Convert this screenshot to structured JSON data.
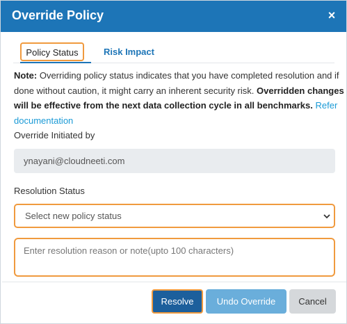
{
  "dialog": {
    "title": "Override Policy",
    "close_glyph": "×"
  },
  "tabs": [
    {
      "label": "Policy Status",
      "active": true
    },
    {
      "label": "Risk Impact",
      "active": false
    }
  ],
  "note": {
    "prefix": "Note:",
    "text": " Overriding policy status indicates that you have completed resolution and if done without caution, it might carry an inherent security risk. ",
    "bold": "Overridden changes will be effective from the next data collection cycle in all benchmarks.",
    "link": "Refer documentation"
  },
  "override_initiated": {
    "label": "Override Initiated by",
    "value": "ynayani@cloudneeti.com"
  },
  "resolution": {
    "label": "Resolution Status",
    "select_value": "Select new policy status",
    "note_placeholder": "Enter resolution reason or note(upto 100 characters)"
  },
  "buttons": {
    "resolve": "Resolve",
    "undo": "Undo Override",
    "cancel": "Cancel"
  },
  "colors": {
    "header": "#1d75b7",
    "focus_outline": "#f09a3e",
    "link": "#1a9ad6",
    "resolve": "#1c5f9c",
    "undo": "#6aaedb",
    "cancel": "#d5d8db"
  },
  "icons": {
    "close": "close-icon",
    "select": "chevron-down-icon"
  }
}
